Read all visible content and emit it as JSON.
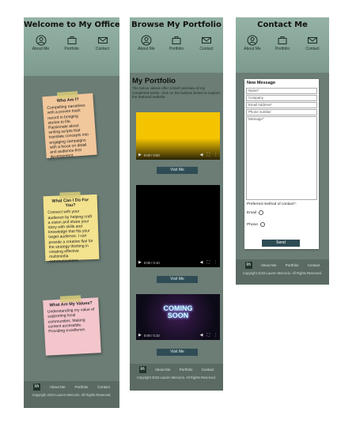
{
  "nav": {
    "about": "About Me",
    "portfolio": "Portfolio",
    "contact": "Contact"
  },
  "office": {
    "title": "Welcome to My Office",
    "notes": [
      {
        "title": "Who Am I?",
        "body": "Compelling narratives with a proven track record in bringing stories to life. Passionate about writing scripts that translate concepts into engaging campaigns with a focus on detail and audience-first development."
      },
      {
        "title": "What Can I Do For You?",
        "body": "Connect with your audience by helping craft a vision and share your story with skills and knowledge that fits your target audience. I can provide a creative flair for the strategy thinking in creating effective multimedia communications."
      },
      {
        "title": "What Are My Values?",
        "body": "Understanding my value of supporting local communities. Making content accessible. Providing excellence."
      }
    ]
  },
  "portfolio": {
    "title": "Browse My Portfolio",
    "heading": "My Portfolio",
    "description": "The below videos offer a brief overview of my completed works, click on the buttons below to explore the featured website.",
    "videos": [
      {
        "time": "0:00 / 0:00",
        "button": "Visit Me"
      },
      {
        "time": "0:00 / 0:10",
        "button": "Visit Me"
      },
      {
        "time": "0:00 / 0:10",
        "button": "Visit Me",
        "overlay": "COMING SOON"
      }
    ]
  },
  "contact": {
    "title": "Contact Me",
    "form_title": "New Message",
    "fields": [
      "Name*",
      "Company",
      "Email Address*",
      "Phone number",
      "Message*"
    ],
    "preferred_label": "Preferred method of contact*:",
    "options": [
      "Email",
      "Phone"
    ],
    "send": "Send"
  },
  "footer": {
    "linkedin": "in",
    "links": [
      "About Me",
      "Portfolio",
      "Contact"
    ],
    "copyright": "Copyright 2023 Lauren Mercurio. All Rights Reserved."
  },
  "colors": {
    "page_bg": "#6b7d75",
    "header": "#94b3a5",
    "button": "#2f4c55",
    "footer": "#5b6b64"
  }
}
